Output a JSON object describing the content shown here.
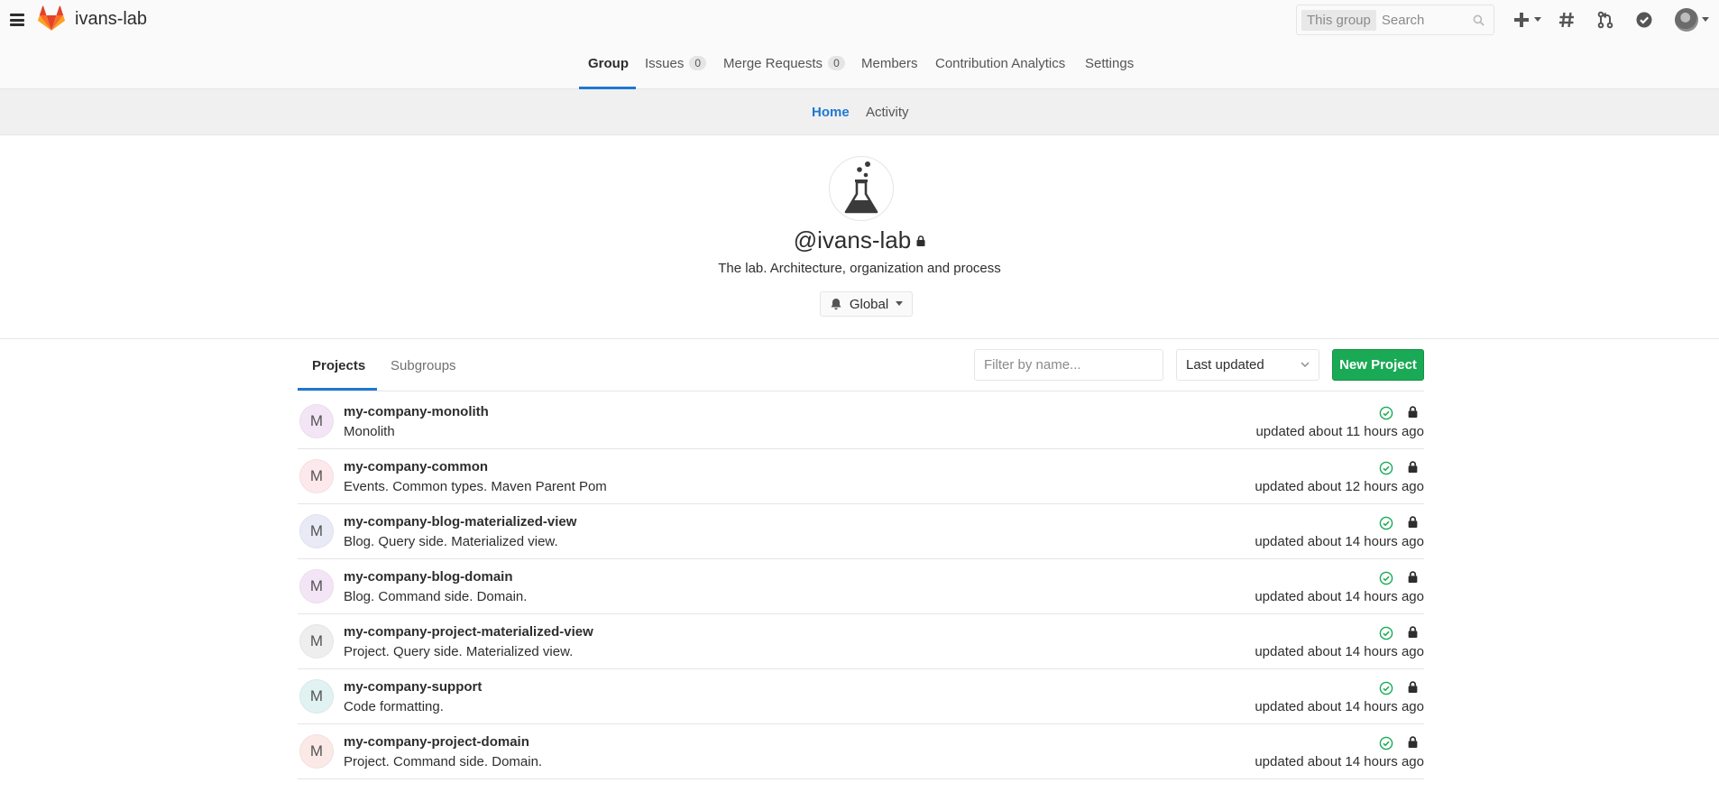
{
  "header": {
    "brand": "ivans-lab",
    "search_scope": "This group",
    "search_placeholder": "Search"
  },
  "group_nav": {
    "items": [
      {
        "label": "Group"
      },
      {
        "label": "Issues",
        "count": "0"
      },
      {
        "label": "Merge Requests",
        "count": "0"
      },
      {
        "label": "Members"
      },
      {
        "label": "Contribution Analytics"
      },
      {
        "label": "Settings"
      }
    ]
  },
  "sub_nav": {
    "items": [
      {
        "label": "Home"
      },
      {
        "label": "Activity"
      }
    ]
  },
  "group": {
    "title": "@ivans-lab",
    "description": "The lab. Architecture, organization and process",
    "notification_level": "Global"
  },
  "projects_tabs": {
    "projects": "Projects",
    "subgroups": "Subgroups"
  },
  "toolbar": {
    "filter_placeholder": "Filter by name...",
    "sort": "Last updated",
    "new_project": "New Project"
  },
  "colors": {
    "accent": "#1f78d1",
    "success": "#1aaa55"
  },
  "projects": [
    {
      "initial": "M",
      "name": "my-company-monolith",
      "description": "Monolith",
      "updated": "updated about 11 hours ago",
      "avatar_color": "#f3e5f5"
    },
    {
      "initial": "M",
      "name": "my-company-common",
      "description": "Events. Common types. Maven Parent Pom",
      "updated": "updated about 12 hours ago",
      "avatar_color": "#fde8ec"
    },
    {
      "initial": "M",
      "name": "my-company-blog-materialized-view",
      "description": "Blog. Query side. Materialized view.",
      "updated": "updated about 14 hours ago",
      "avatar_color": "#e8eaf6"
    },
    {
      "initial": "M",
      "name": "my-company-blog-domain",
      "description": "Blog. Command side. Domain.",
      "updated": "updated about 14 hours ago",
      "avatar_color": "#f3e5f5"
    },
    {
      "initial": "M",
      "name": "my-company-project-materialized-view",
      "description": "Project. Query side. Materialized view.",
      "updated": "updated about 14 hours ago",
      "avatar_color": "#eeeeee"
    },
    {
      "initial": "M",
      "name": "my-company-support",
      "description": "Code formatting.",
      "updated": "updated about 14 hours ago",
      "avatar_color": "#e0f2f1"
    },
    {
      "initial": "M",
      "name": "my-company-project-domain",
      "description": "Project. Command side. Domain.",
      "updated": "updated about 14 hours ago",
      "avatar_color": "#fbe9e7"
    }
  ]
}
